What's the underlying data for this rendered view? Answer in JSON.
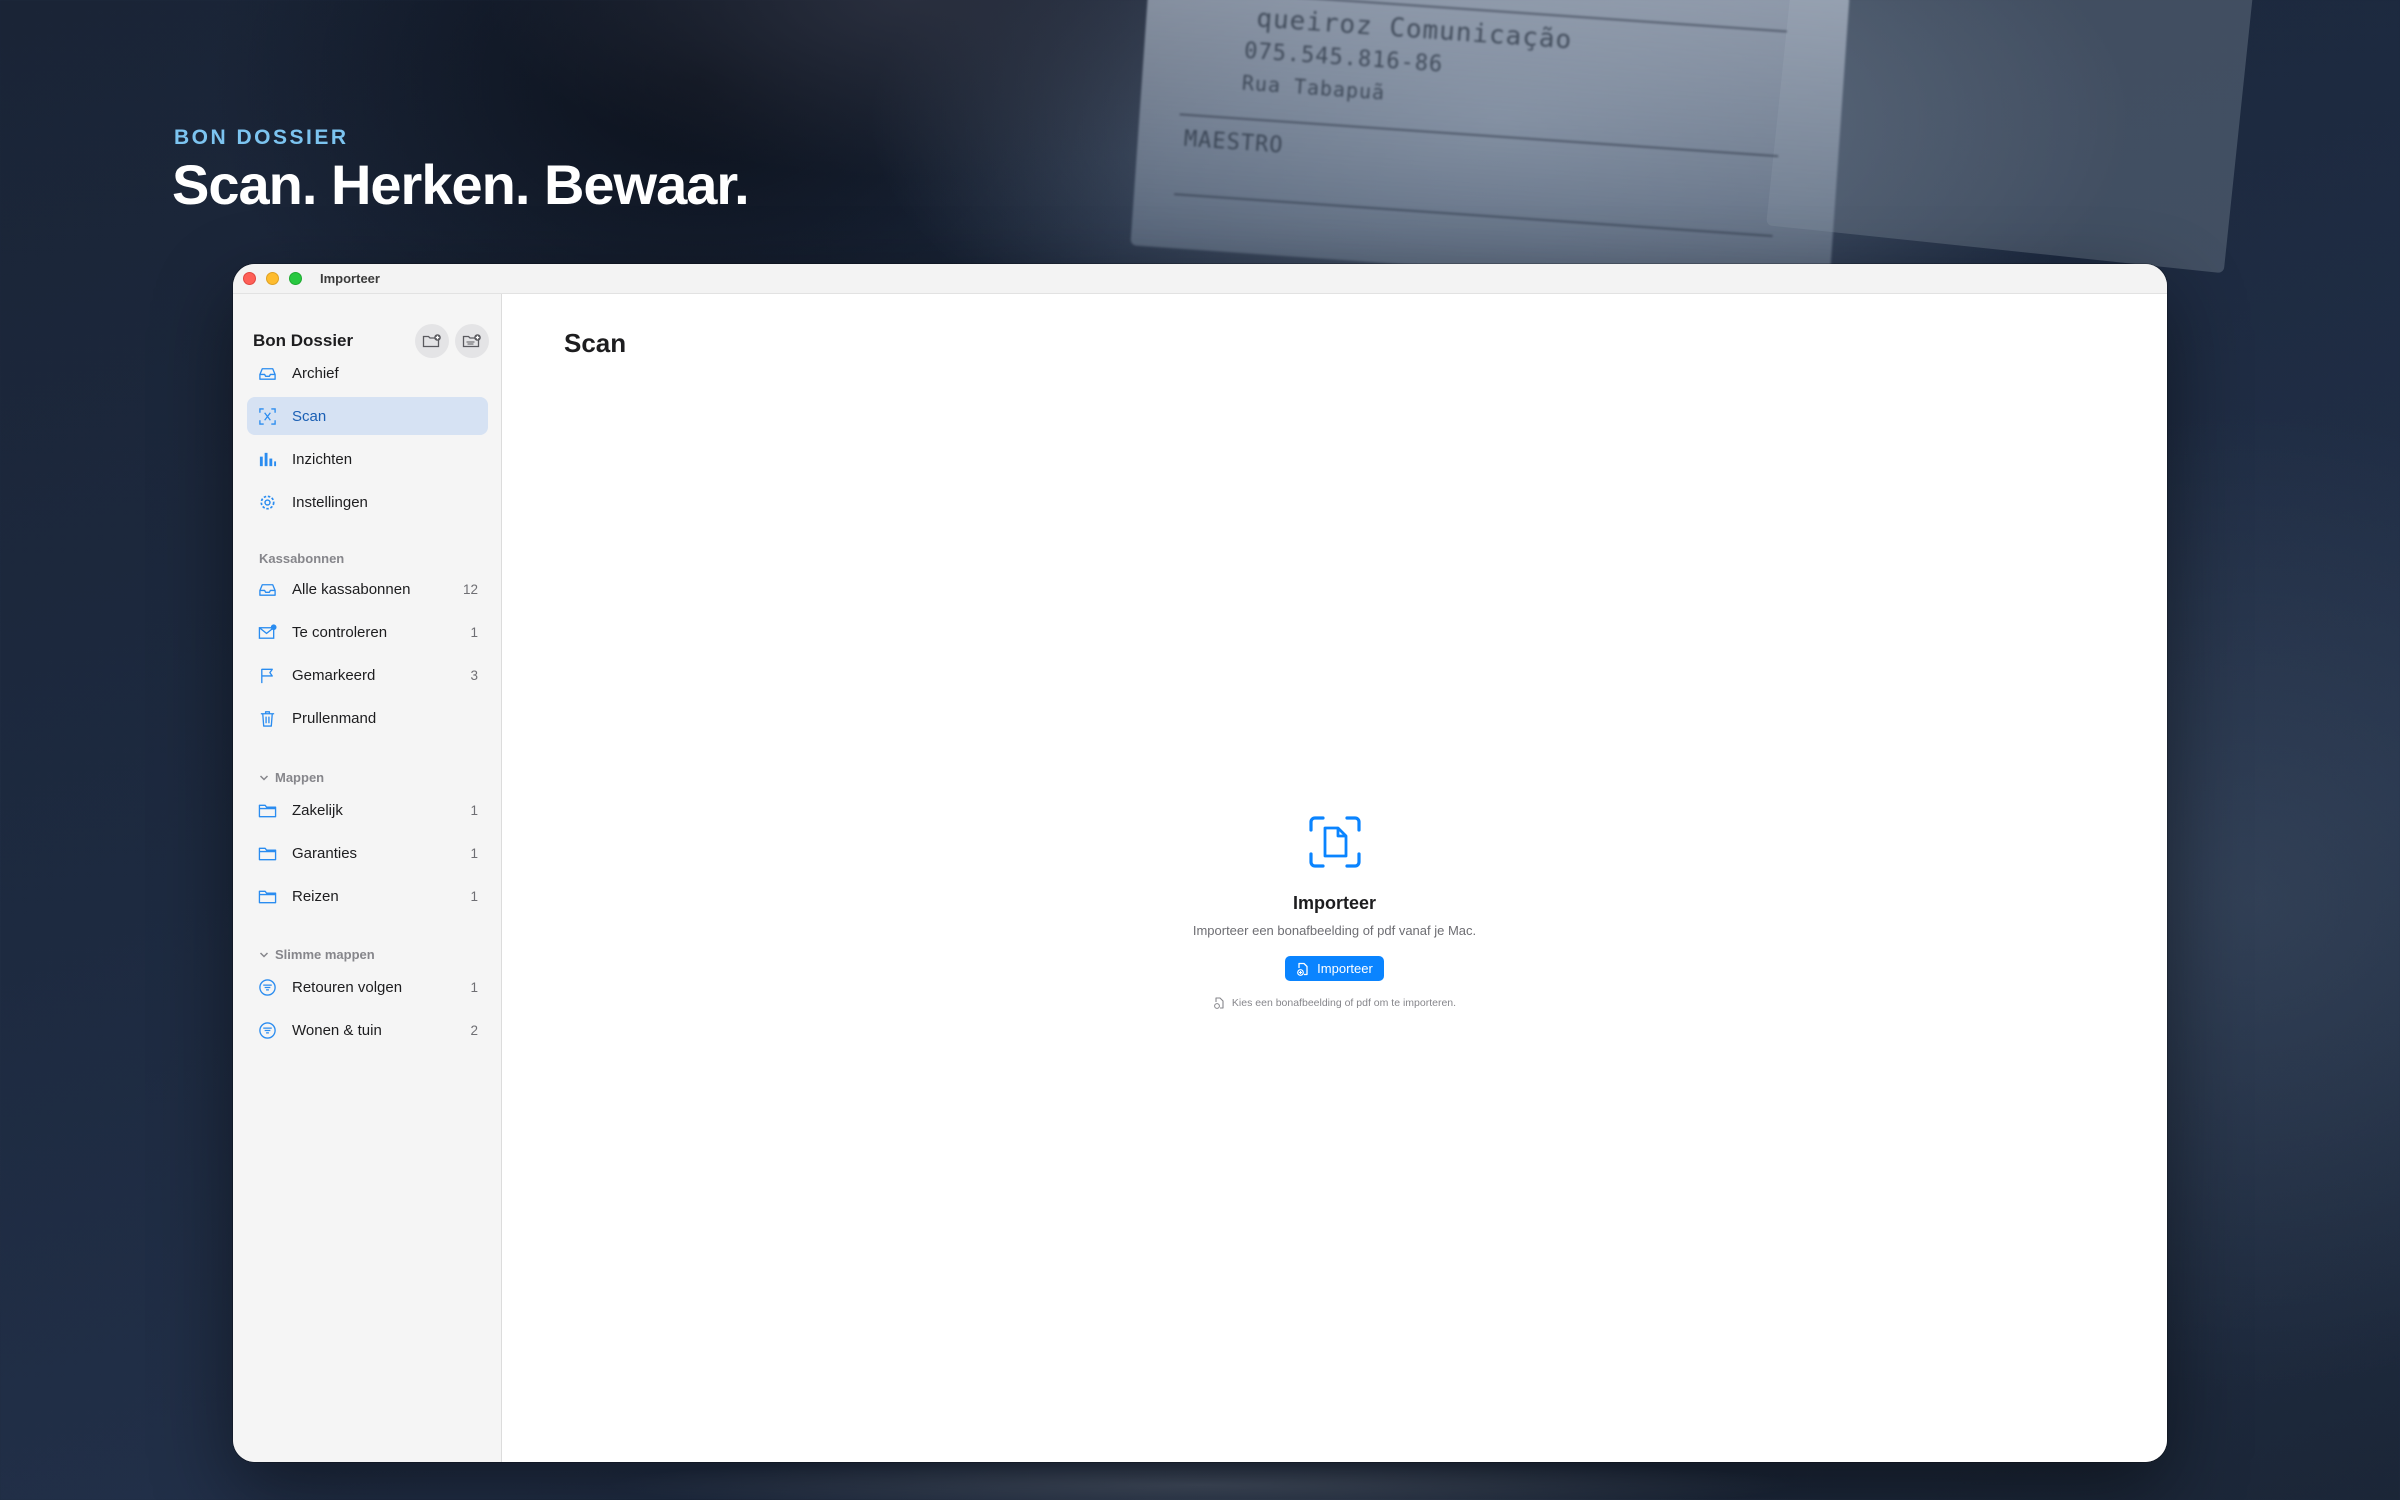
{
  "hero": {
    "eyebrow": "BON DOSSIER",
    "title": "Scan. Herken. Bewaar."
  },
  "background": {
    "receipt_lines": [
      "queiroz Comunicação",
      "075.545.816-86",
      "Rua Tabapuã",
      "MAESTRO"
    ]
  },
  "window": {
    "title": "Importeer"
  },
  "sidebar": {
    "app_name": "Bon Dossier",
    "header_buttons": [
      {
        "icon": "folder-add-icon"
      },
      {
        "icon": "smart-folder-add-icon"
      }
    ],
    "nav": [
      {
        "label": "Archief",
        "icon": "tray-icon"
      },
      {
        "label": "Scan",
        "icon": "scan-icon",
        "active": true
      },
      {
        "label": "Inzichten",
        "icon": "chart-icon"
      },
      {
        "label": "Instellingen",
        "icon": "gear-icon"
      }
    ],
    "receipts_section": "Kassabonnen",
    "receipts": [
      {
        "label": "Alle kassabonnen",
        "count": "12",
        "icon": "tray-icon"
      },
      {
        "label": "Te controleren",
        "count": "1",
        "icon": "envelope-badge-icon"
      },
      {
        "label": "Gemarkeerd",
        "count": "3",
        "icon": "flag-icon"
      },
      {
        "label": "Prullenmand",
        "count": "",
        "icon": "trash-icon"
      }
    ],
    "folders_section": "Mappen",
    "folders": [
      {
        "label": "Zakelijk",
        "count": "1",
        "icon": "folder-icon"
      },
      {
        "label": "Garanties",
        "count": "1",
        "icon": "folder-icon"
      },
      {
        "label": "Reizen",
        "count": "1",
        "icon": "folder-icon"
      }
    ],
    "smart_section": "Slimme mappen",
    "smart_folders": [
      {
        "label": "Retouren volgen",
        "count": "1",
        "icon": "filter-icon"
      },
      {
        "label": "Wonen & tuin",
        "count": "2",
        "icon": "filter-icon"
      }
    ]
  },
  "main": {
    "title": "Scan",
    "empty_state": {
      "icon": "document-scan-icon",
      "title": "Importeer",
      "subtitle": "Importeer een bonafbeelding of pdf vanaf je Mac.",
      "button_label": "Importeer",
      "hint": "Kies een bonafbeelding of pdf om te importeren."
    }
  },
  "colors": {
    "accent": "#0a84ff",
    "eyebrow": "#7cc4f0",
    "sidebar_selected": "#d6e2f3"
  }
}
